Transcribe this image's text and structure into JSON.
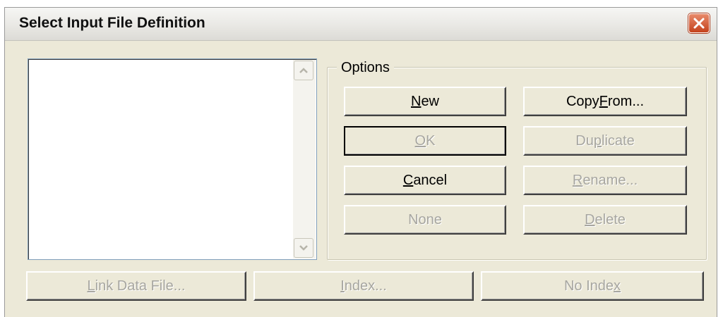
{
  "dialog": {
    "title": "Select Input File Definition",
    "close_icon": "close-icon",
    "accent_close": "#c4421c"
  },
  "listbox": {
    "items": []
  },
  "options": {
    "label": "Options",
    "new": {
      "pre": "",
      "key": "N",
      "post": "ew",
      "enabled": true
    },
    "copy_from": {
      "pre": "Copy ",
      "key": "F",
      "post": "rom...",
      "enabled": true
    },
    "ok": {
      "pre": "",
      "key": "O",
      "post": "K",
      "enabled": false
    },
    "duplicate": {
      "pre": "Du",
      "key": "p",
      "post": "licate",
      "enabled": false
    },
    "cancel": {
      "pre": "",
      "key": "C",
      "post": "ancel",
      "enabled": true
    },
    "rename": {
      "pre": "",
      "key": "R",
      "post": "ename...",
      "enabled": false
    },
    "none": {
      "pre": "None",
      "key": "",
      "post": "",
      "enabled": false
    },
    "delete": {
      "pre": "",
      "key": "D",
      "post": "elete",
      "enabled": false
    }
  },
  "bottom": {
    "link_data_file": {
      "pre": "",
      "key": "L",
      "post": "ink Data File...",
      "enabled": false
    },
    "index": {
      "pre": "",
      "key": "I",
      "post": "ndex...",
      "enabled": false
    },
    "no_index": {
      "pre": "No Inde",
      "key": "x",
      "post": "",
      "enabled": false
    }
  }
}
